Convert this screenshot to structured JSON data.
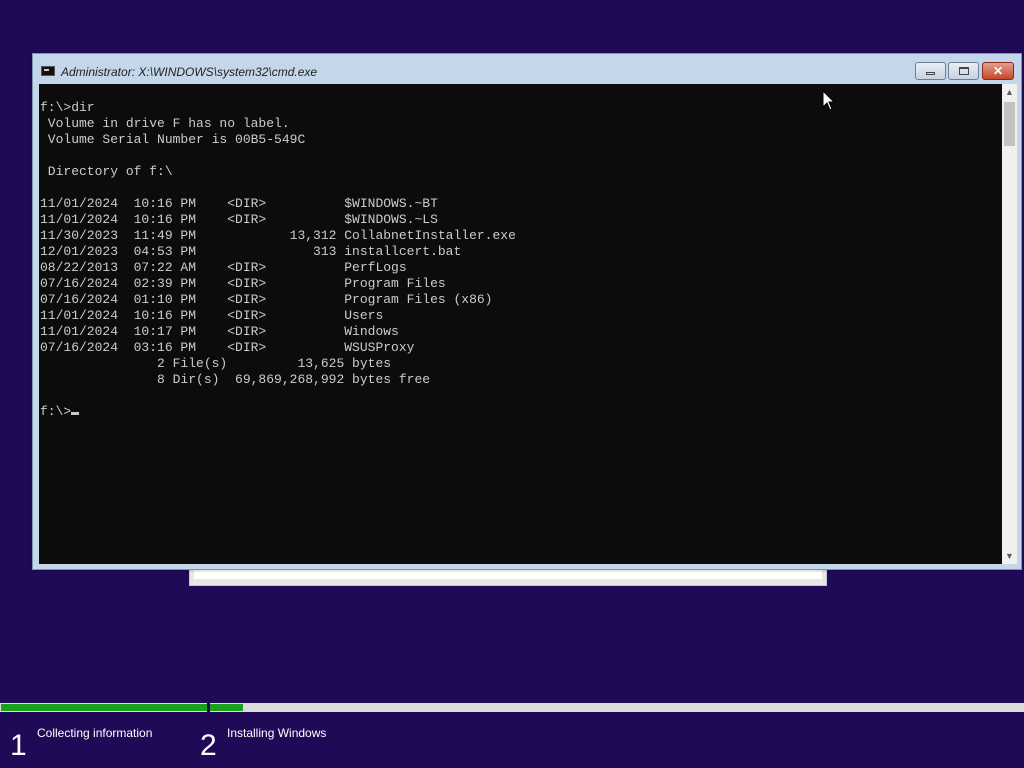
{
  "window": {
    "title": "Administrator: X:\\WINDOWS\\system32\\cmd.exe",
    "icon": "console-icon",
    "buttons": {
      "minimize": "minimize-icon",
      "maximize": "maximize-icon",
      "close": "✕"
    }
  },
  "console": {
    "lines": [
      "f:\\>dir",
      " Volume in drive F has no label.",
      " Volume Serial Number is 00B5-549C",
      "",
      " Directory of f:\\",
      "",
      "11/01/2024  10:16 PM    <DIR>          $WINDOWS.~BT",
      "11/01/2024  10:16 PM    <DIR>          $WINDOWS.~LS",
      "11/30/2023  11:49 PM            13,312 CollabnetInstaller.exe",
      "12/01/2023  04:53 PM               313 installcert.bat",
      "08/22/2013  07:22 AM    <DIR>          PerfLogs",
      "07/16/2024  02:39 PM    <DIR>          Program Files",
      "07/16/2024  01:10 PM    <DIR>          Program Files (x86)",
      "11/01/2024  10:16 PM    <DIR>          Users",
      "11/01/2024  10:17 PM    <DIR>          Windows",
      "07/16/2024  03:16 PM    <DIR>          WSUSProxy",
      "               2 File(s)         13,625 bytes",
      "               8 Dir(s)  69,869,268,992 bytes free",
      ""
    ],
    "prompt": "f:\\>"
  },
  "progress": {
    "step1_fraction": 1.0,
    "step2_fraction": 0.04,
    "color": "#1aa31a"
  },
  "steps": [
    {
      "number": "1",
      "label": "Collecting information"
    },
    {
      "number": "2",
      "label": "Installing Windows"
    }
  ],
  "colors": {
    "background": "#200a58",
    "console_bg": "#0c0c0c",
    "console_text": "#cccccc"
  }
}
